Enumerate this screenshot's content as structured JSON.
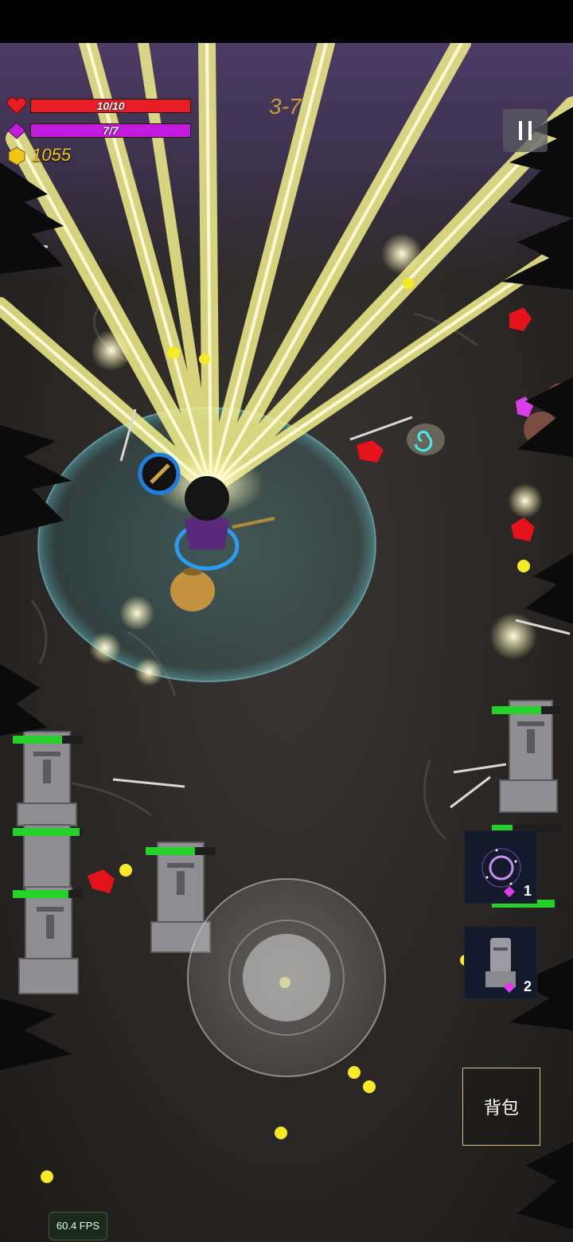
{
  "hud": {
    "health_text": "10/10",
    "health_fraction": 1.0,
    "mana_text": "7/7",
    "mana_fraction": 1.0,
    "coins": "1055",
    "level": "3-7",
    "health_color": "#e81c24",
    "mana_color": "#c31bdc"
  },
  "skills": [
    {
      "icon": "vortex-skill-icon",
      "cost": "1"
    },
    {
      "icon": "moai-statue-skill-icon",
      "cost": "2"
    }
  ],
  "bag_label": "背包",
  "fps": "60.4 FPS",
  "enemy_health": [
    0.7,
    0.95,
    0.8,
    0.7,
    0.7,
    0.3,
    0.9
  ]
}
